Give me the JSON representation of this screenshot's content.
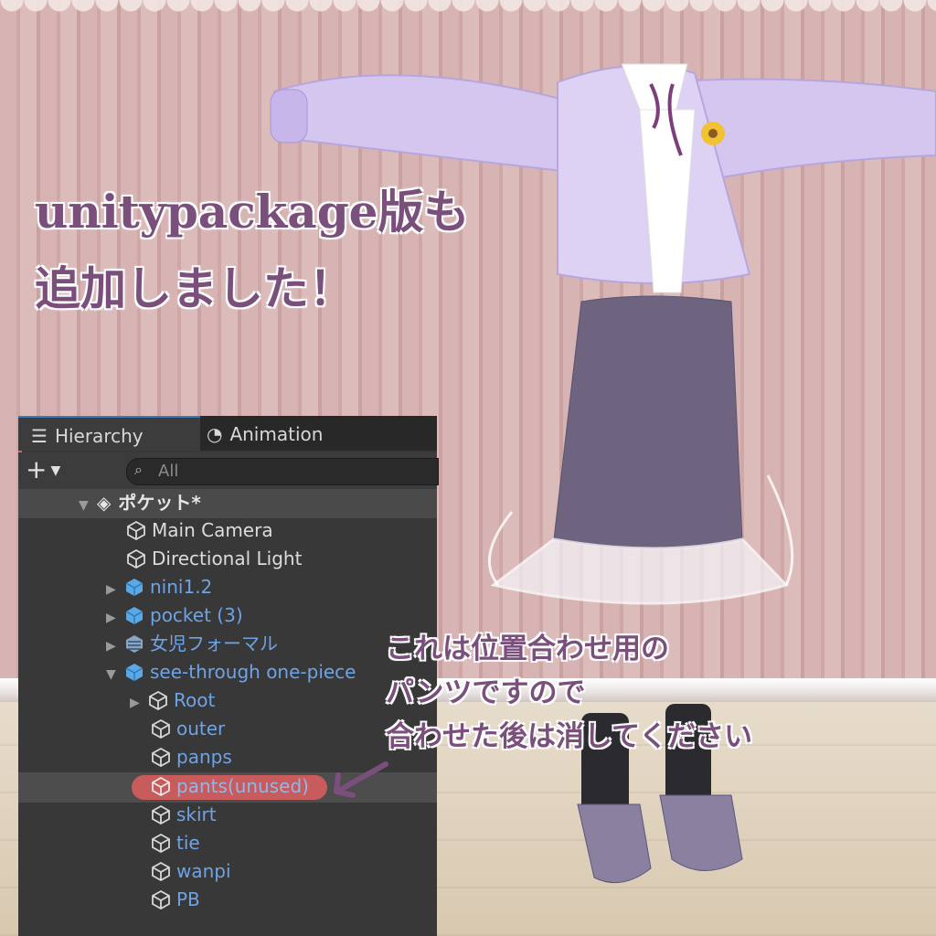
{
  "headline": {
    "line1": "unitypackage版も",
    "line2": "追加しました！"
  },
  "hierarchy": {
    "tabs": [
      {
        "label": "Hierarchy",
        "icon": "list-icon"
      },
      {
        "label": "Animation",
        "icon": "clock-icon"
      }
    ],
    "search_placeholder": "All",
    "scene_name": "ポケット*",
    "items": [
      {
        "label": "Main Camera"
      },
      {
        "label": "Directional Light"
      },
      {
        "label": "nini1.2"
      },
      {
        "label": "pocket (3)"
      },
      {
        "label": "女児フォーマル"
      },
      {
        "label": "see-through  one-piece"
      },
      {
        "label": "Root"
      },
      {
        "label": "outer"
      },
      {
        "label": "panps"
      },
      {
        "label": "pants(unused)"
      },
      {
        "label": "skirt"
      },
      {
        "label": "tie"
      },
      {
        "label": "wanpi"
      },
      {
        "label": "PB"
      }
    ]
  },
  "note": {
    "line1": "これは位置合わせ用の",
    "line2": "パンツですので",
    "line3": "合わせた後は消してください"
  },
  "colors": {
    "accent_text": "#7a4f7c",
    "prefab_blue": "#6ea3e6",
    "highlight_red": "#c85b5b"
  }
}
